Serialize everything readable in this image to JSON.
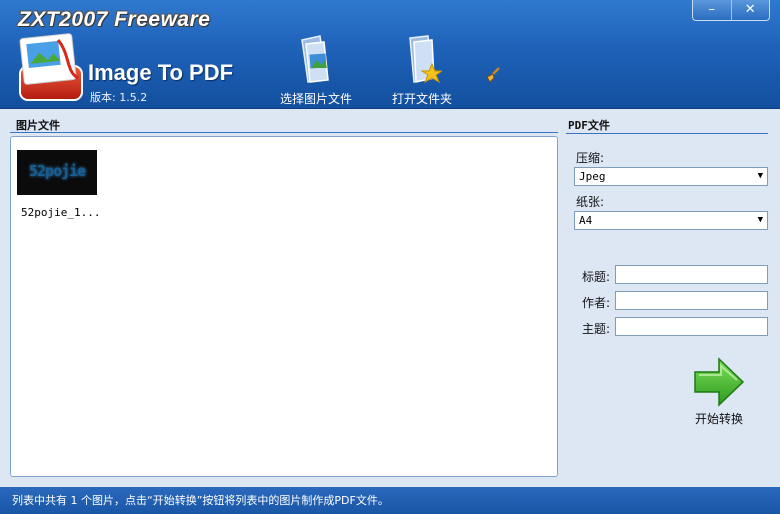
{
  "header": {
    "brand": "ZXT2007 Freeware",
    "app_title": "Image To PDF",
    "version": "版本: 1.5.2",
    "window_controls": {
      "minimize": "–",
      "close": "✕"
    },
    "toolbar": [
      {
        "label": "选择图片文件",
        "icon": "select-image-files-icon"
      },
      {
        "label": "打开文件夹",
        "icon": "open-folder-icon"
      }
    ],
    "extra_icon": "broom-icon"
  },
  "left_panel": {
    "title": "图片文件",
    "files": [
      {
        "thumb_text": "52pojie",
        "caption": "52pojie_1..."
      }
    ]
  },
  "right_panel": {
    "title": "PDF文件",
    "compression": {
      "label": "压缩:",
      "value": "Jpeg"
    },
    "paper": {
      "label": "纸张:",
      "value": "A4"
    },
    "fields": {
      "title": {
        "label": "标题:",
        "value": ""
      },
      "author": {
        "label": "作者:",
        "value": ""
      },
      "subject": {
        "label": "主题:",
        "value": ""
      }
    },
    "start_button": {
      "label": "开始转换",
      "icon": "green-arrow-icon"
    }
  },
  "status": {
    "text": "列表中共有 1 个图片，点击“开始转换”按钮将列表中的图片制作成PDF文件。"
  },
  "colors": {
    "header_blue": "#1e62b8",
    "panel_bg": "#dde7f4",
    "status_blue": "#1a56a6",
    "accent_green": "#3cb02a"
  }
}
